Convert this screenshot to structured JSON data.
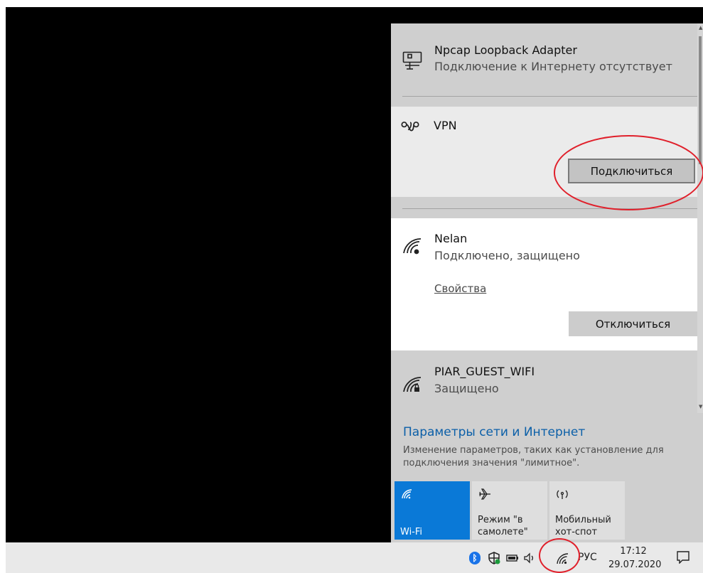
{
  "flyout": {
    "networks": [
      {
        "name": "Npcap Loopback Adapter",
        "status": "Подключение к Интернету отсутствует",
        "icon": "ethernet-icon"
      },
      {
        "name": "VPN",
        "icon": "vpn-icon",
        "button": "Подключиться"
      },
      {
        "name": "Nelan",
        "status": "Подключено, защищено",
        "icon": "wifi-icon",
        "properties_link": "Свойства",
        "button": "Отключиться"
      },
      {
        "name": "PIAR_GUEST_WIFI",
        "status": "Защищено",
        "icon": "wifi-secured-icon"
      }
    ],
    "settings_link": "Параметры сети и Интернет",
    "settings_desc": "Изменение параметров, таких как установление для подключения значения \"лимитное\".",
    "tiles": [
      {
        "label": "Wi-Fi",
        "icon": "wifi-icon",
        "active": true
      },
      {
        "label": "Режим \"в самолете\"",
        "icon": "airplane-icon",
        "active": false
      },
      {
        "label": "Мобильный хот-спот",
        "icon": "hotspot-icon",
        "active": false
      }
    ]
  },
  "taskbar": {
    "language": "РУС",
    "time": "17:12",
    "date": "29.07.2020",
    "tray_icons": [
      "bluetooth-icon",
      "defender-icon",
      "battery-icon",
      "volume-icon",
      "wifi-icon"
    ]
  },
  "colors": {
    "accent": "#0a79d7",
    "link": "#0b5fa8",
    "annotation": "#e0202b"
  }
}
